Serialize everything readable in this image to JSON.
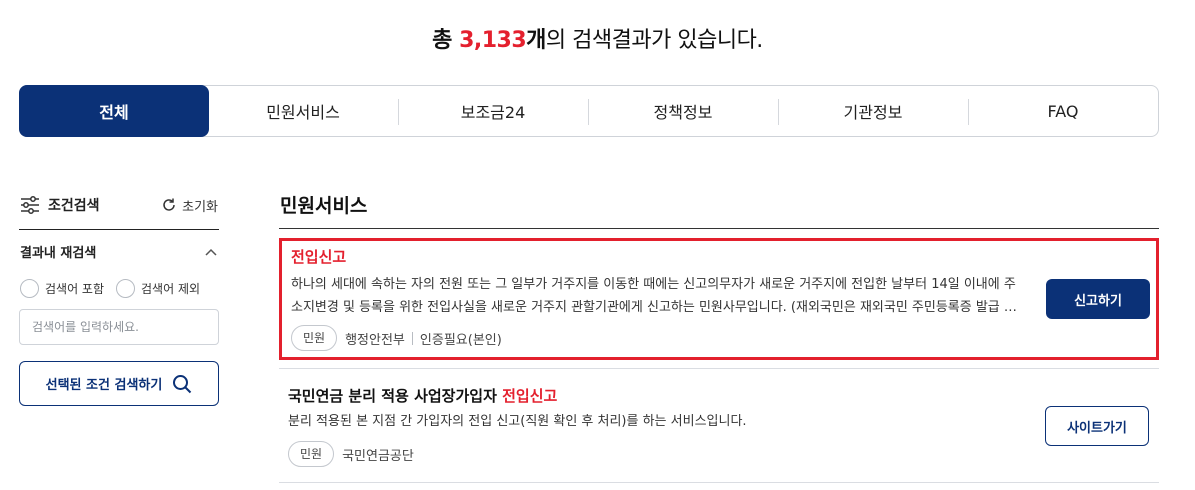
{
  "summary": {
    "prefix": "총 ",
    "count": "3,133",
    "unit": "개",
    "suffix": "의 검색결과가 있습니다."
  },
  "tabs": [
    {
      "label": "전체",
      "active": true
    },
    {
      "label": "민원서비스"
    },
    {
      "label": "보조금24"
    },
    {
      "label": "정책정보"
    },
    {
      "label": "기관정보"
    },
    {
      "label": "FAQ"
    }
  ],
  "sidebar": {
    "title": "조건검색",
    "reset_label": "초기화",
    "refine_label": "결과내 재검색",
    "include_label": "검색어 포함",
    "exclude_label": "검색어 제외",
    "input_placeholder": "검색어를 입력하세요.",
    "apply_label": "선택된 조건 검색하기"
  },
  "main": {
    "section_title": "민원서비스",
    "results": [
      {
        "title_plain": "",
        "title_highlight": "전입신고",
        "description": "하나의 세대에 속하는 자의 전원 또는 그 일부가 거주지를 이동한 때에는 신고의무자가 새로운 거주지에 전입한 날부터 14일 이내에 주소지변경 및 등록을 위한 전입사실을 새로운 거주지 관할기관에게 신고하는 민원사무입니다. (재외국민은 재외국민 주민등록증 발급 포함)",
        "tag": "민원",
        "agency": "행정안전부",
        "auth": "인증필요(본인)",
        "button": "신고하기"
      },
      {
        "title_plain": "국민연금 분리 적용 사업장가입자 ",
        "title_highlight": "전입신고",
        "description": "분리 적용된 본 지점 간 가입자의 전입 신고(직원 확인 후 처리)를 하는 서비스입니다.",
        "tag": "민원",
        "agency": "국민연금공단",
        "button": "사이트가기"
      }
    ]
  },
  "colors": {
    "brand": "#0b3177",
    "highlight": "#e4202e"
  }
}
